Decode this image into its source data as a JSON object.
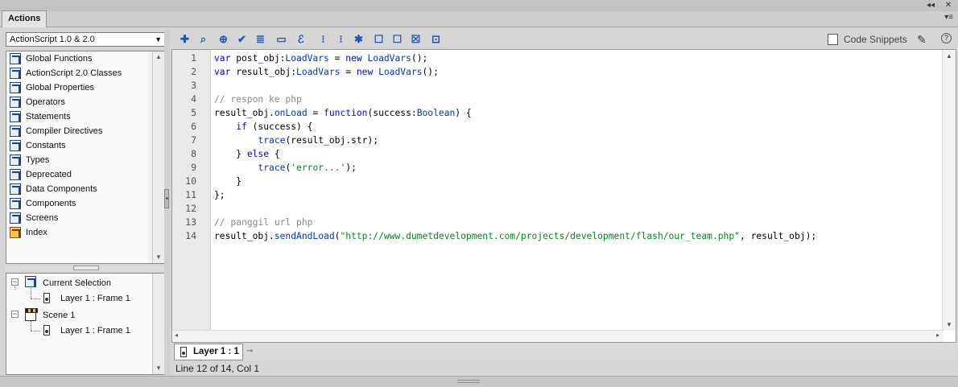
{
  "panel": {
    "tab_label": "Actions",
    "collapse_glyph": "◂◂",
    "close_glyph": "✕",
    "menu_glyph": "▾≡"
  },
  "language_select": {
    "value": "ActionScript 1.0 & 2.0",
    "arrow": "▼"
  },
  "toolbox": {
    "items": [
      {
        "label": "Global Functions",
        "icon": "book-icon"
      },
      {
        "label": "ActionScript 2.0 Classes",
        "icon": "book-icon"
      },
      {
        "label": "Global Properties",
        "icon": "book-icon"
      },
      {
        "label": "Operators",
        "icon": "book-icon"
      },
      {
        "label": "Statements",
        "icon": "book-icon"
      },
      {
        "label": "Compiler Directives",
        "icon": "book-icon"
      },
      {
        "label": "Constants",
        "icon": "book-icon"
      },
      {
        "label": "Types",
        "icon": "book-icon"
      },
      {
        "label": "Deprecated",
        "icon": "book-icon"
      },
      {
        "label": "Data Components",
        "icon": "book-icon"
      },
      {
        "label": "Components",
        "icon": "book-icon"
      },
      {
        "label": "Screens",
        "icon": "book-icon"
      },
      {
        "label": "Index",
        "icon": "index-book-icon"
      }
    ]
  },
  "script_navigator": {
    "current_selection": "Current Selection",
    "current_frame": "Layer 1 : Frame 1",
    "scene": "Scene 1",
    "scene_frame": "Layer 1 : Frame 1",
    "expand_glyph": "−"
  },
  "toolbar": {
    "buttons": [
      {
        "name": "add-item-icon",
        "glyph": "✚"
      },
      {
        "name": "find-icon",
        "glyph": "⌕"
      },
      {
        "name": "insert-target-path-icon",
        "glyph": "⊕"
      },
      {
        "name": "check-syntax-icon",
        "glyph": "✔"
      },
      {
        "name": "auto-format-icon",
        "glyph": "≣"
      },
      {
        "name": "show-code-hint-icon",
        "glyph": "▭"
      },
      {
        "name": "debug-options-icon",
        "glyph": "ℰ"
      },
      {
        "name": "collapse-between-braces-icon",
        "glyph": "⁝"
      },
      {
        "name": "collapse-selection-icon",
        "glyph": "⁝"
      },
      {
        "name": "expand-all-icon",
        "glyph": "✱"
      },
      {
        "name": "apply-block-comment-icon",
        "glyph": "☐"
      },
      {
        "name": "apply-line-comment-icon",
        "glyph": "☐"
      },
      {
        "name": "remove-comment-icon",
        "glyph": "☒"
      },
      {
        "name": "show-hide-toolbox-icon",
        "glyph": "⊡"
      }
    ],
    "code_snippets_label": "Code Snippets",
    "wand_glyph": "✎",
    "help_glyph": "?"
  },
  "editor": {
    "scroll_up": "▲",
    "scroll_down": "▼",
    "scroll_left": "◂",
    "scroll_right": "▸",
    "lines": [
      [
        {
          "t": "var",
          "c": "kw"
        },
        {
          "t": " post_obj:"
        },
        {
          "t": "LoadVars",
          "c": "ty"
        },
        {
          "t": " = "
        },
        {
          "t": "new",
          "c": "kw"
        },
        {
          "t": " "
        },
        {
          "t": "LoadVars",
          "c": "ty"
        },
        {
          "t": "();"
        }
      ],
      [
        {
          "t": "var",
          "c": "kw"
        },
        {
          "t": " result_obj:"
        },
        {
          "t": "LoadVars",
          "c": "ty"
        },
        {
          "t": " = "
        },
        {
          "t": "new",
          "c": "kw"
        },
        {
          "t": " "
        },
        {
          "t": "LoadVars",
          "c": "ty"
        },
        {
          "t": "();"
        }
      ],
      [],
      [
        {
          "t": "// respon ke php",
          "c": "cm"
        }
      ],
      [
        {
          "t": "result_obj."
        },
        {
          "t": "onLoad",
          "c": "fn"
        },
        {
          "t": " = "
        },
        {
          "t": "function",
          "c": "kw"
        },
        {
          "t": "(success:"
        },
        {
          "t": "Boolean",
          "c": "ty"
        },
        {
          "t": ") {"
        }
      ],
      [
        {
          "t": "    "
        },
        {
          "t": "if",
          "c": "kw"
        },
        {
          "t": " (success) {"
        }
      ],
      [
        {
          "t": "        "
        },
        {
          "t": "trace",
          "c": "fn"
        },
        {
          "t": "(result_obj.str);"
        }
      ],
      [
        {
          "t": "    } "
        },
        {
          "t": "else",
          "c": "kw"
        },
        {
          "t": " {"
        }
      ],
      [
        {
          "t": "        "
        },
        {
          "t": "trace",
          "c": "fn"
        },
        {
          "t": "("
        },
        {
          "t": "'error...'",
          "c": "st"
        },
        {
          "t": ");"
        }
      ],
      [
        {
          "t": "    }"
        }
      ],
      [
        {
          "t": "};"
        }
      ],
      [],
      [
        {
          "t": "// panggil url php",
          "c": "cm"
        }
      ],
      [
        {
          "t": "result_obj."
        },
        {
          "t": "sendAndLoad",
          "c": "fn"
        },
        {
          "t": "("
        },
        {
          "t": "\"http://www.dumetdevelopment.com/projects/development/flash/our_team.php\"",
          "c": "st"
        },
        {
          "t": ", result_obj);"
        }
      ]
    ]
  },
  "script_tab": {
    "label": "Layer 1 : 1",
    "pin_glyph": "⊸"
  },
  "status": {
    "text": "Line 12 of 14, Col 1"
  }
}
